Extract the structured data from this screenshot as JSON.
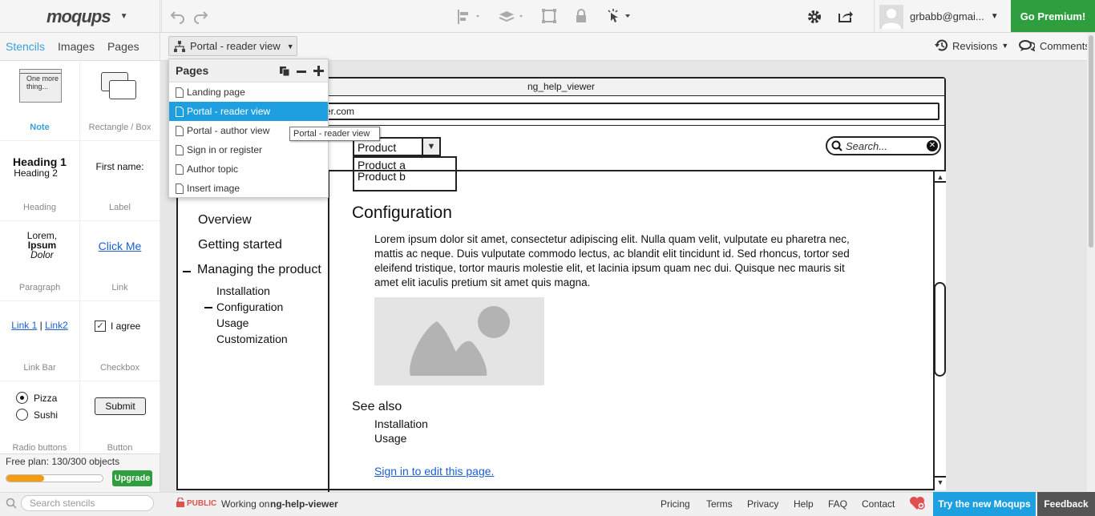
{
  "app": {
    "logo": "moqups",
    "user": "grbabb@gmai...",
    "go_premium": "Go Premium!"
  },
  "panel_tabs": [
    "Stencils",
    "Images",
    "Pages"
  ],
  "page_selector": "Portal - reader view",
  "toolbar_right": {
    "revisions": "Revisions",
    "comments": "Comments"
  },
  "stencils": [
    {
      "caption": "Note",
      "preview": "One more thing..."
    },
    {
      "caption": "Rectangle / Box"
    },
    {
      "caption": "Heading",
      "h1": "Heading 1",
      "h2": "Heading 2"
    },
    {
      "caption": "Label",
      "text": "First name:"
    },
    {
      "caption": "Paragraph",
      "l1": "Lorem,",
      "l2": "Ipsum",
      "l3": "Dolor"
    },
    {
      "caption": "Link",
      "text": "Click Me"
    },
    {
      "caption": "Link Bar",
      "l1": "Link 1",
      "sep": "|",
      "l2": "Link2"
    },
    {
      "caption": "Checkbox",
      "text": "I agree"
    },
    {
      "caption": "Radio buttons",
      "r1": "Pizza",
      "r2": "Sushi"
    },
    {
      "caption": "Button",
      "text": "Submit"
    }
  ],
  "plan": {
    "text": "Free plan: 130/300 objects",
    "used": 130,
    "total": 300,
    "upgrade": "Upgrade"
  },
  "search_stencils_placeholder": "Search stencils",
  "pages_menu": {
    "title": "Pages",
    "items": [
      "Landing page",
      "Portal - reader view",
      "Portal - author view",
      "Sign in or register",
      "Author topic",
      "Insert image"
    ],
    "selected_index": 1
  },
  "tooltip": "Portal - reader view",
  "mockup": {
    "window_title": "ng_help_viewer",
    "url_visible": "ver.com",
    "product_select": "Product",
    "product_options": [
      "Product a",
      "Product b"
    ],
    "search_placeholder": "Search...",
    "nav": {
      "top": [
        "Overview",
        "Getting started",
        "Managing the product"
      ],
      "sub": [
        "Installation",
        "Configuration",
        "Usage",
        "Customization"
      ]
    },
    "heading": "Configuration",
    "paragraph": [
      "Lorem ipsum dolor sit amet, consectetur adipiscing elit. Nulla quam velit, vulputate eu pharetra nec,",
      "mattis ac neque. Duis vulputate commodo lectus, ac blandit elit tincidunt id. Sed rhoncus, tortor sed",
      "eleifend tristique, tortor mauris molestie elit, et lacinia ipsum quam nec dui. Quisque nec mauris sit",
      "amet elit iaculis pretium sit amet quis magna."
    ],
    "see_also": "See also",
    "see_also_links": [
      "Installation",
      "Usage"
    ],
    "sign_in_link": "Sign in to edit this page."
  },
  "footer": {
    "public": "PUBLIC",
    "working_on": "Working on",
    "project": "ng-help-viewer",
    "links": [
      "Pricing",
      "Terms",
      "Privacy",
      "Help",
      "FAQ",
      "Contact"
    ],
    "try_new": "Try the new Moqups",
    "feedback": "Feedback"
  },
  "colors": {
    "accent": "#3ba0d8",
    "premium": "#2e9e3e",
    "selected": "#1ea0e0",
    "progress": "#f39c12"
  }
}
